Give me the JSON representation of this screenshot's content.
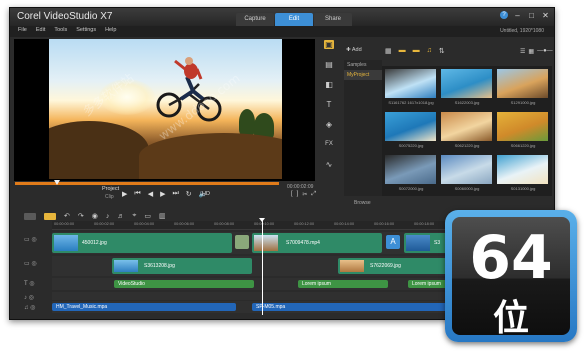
{
  "app": {
    "title": "Corel VideoStudio X7"
  },
  "mode_tabs": [
    "Capture",
    "Edit",
    "Share"
  ],
  "menu": [
    "File",
    "Edit",
    "Tools",
    "Settings",
    "Help"
  ],
  "resolution": "Untitled, 1920*1080",
  "preview": {
    "project_label": "Project",
    "clip_label": "Clip",
    "hd_label": "HD",
    "timecode": "00:00:02:09"
  },
  "library": {
    "add_label": "Add",
    "folders": [
      "Samples",
      "MyProject"
    ],
    "browse_label": "Browse",
    "thumbnails": [
      {
        "label": "S1161762 1617x1018.jpg",
        "colors": [
          "#3a3a3a",
          "#bfe1f5",
          "#2f7fc0"
        ]
      },
      {
        "label": "S1622003.jpg",
        "colors": [
          "#5fb8e6",
          "#2d8ec6",
          "#e8c08a"
        ]
      },
      {
        "label": "S1291000.jpg",
        "colors": [
          "#9cc7e6",
          "#d9a35c",
          "#6b4a2a"
        ]
      },
      {
        "label": "S0075220.jpg",
        "colors": [
          "#3aa0d8",
          "#1e78b8",
          "#f2e6c8"
        ]
      },
      {
        "label": "S0621220.jpg",
        "colors": [
          "#c98a4a",
          "#f2d5a0",
          "#8a5a2a"
        ]
      },
      {
        "label": "S0661220.jpg",
        "colors": [
          "#e5b23a",
          "#d08a2a",
          "#6a9a3a"
        ]
      },
      {
        "label": "S0072000.jpg",
        "colors": [
          "#2a2a2a",
          "#7a9ab8",
          "#4a6a8a"
        ]
      },
      {
        "label": "S0060000.jpg",
        "colors": [
          "#5a8ac0",
          "#c8dbe8",
          "#8aa6c0"
        ]
      },
      {
        "label": "S0131000.jpg",
        "colors": [
          "#3fa0d0",
          "#e9f3f7",
          "#f2e3c0"
        ]
      }
    ]
  },
  "timeline": {
    "ruler": [
      "00:00:00:00",
      "00:00:02:00",
      "00:00:04:00",
      "00:00:06:00",
      "00:00:08:00",
      "00:00:10:00",
      "00:00:12:00",
      "00:00:14:00",
      "00:00:16:00",
      "00:00:18:00",
      "00:00:20:00"
    ],
    "video_clips": [
      "450012.jpg",
      "S7009478.mp4",
      "S3"
    ],
    "overlay_clips": [
      "S3613208.jpg",
      "S7622069.jpg"
    ],
    "title_clips": [
      "VideoStudio",
      "Lorem ipsum",
      "Lorem ipsum"
    ],
    "audio_clips": [
      "HM_Travel_Music.mpa",
      "SP-M05.mpa"
    ]
  },
  "badge": {
    "number": "64",
    "text": "位",
    "color": "#3d8fd6"
  },
  "watermark": "多多软件站"
}
